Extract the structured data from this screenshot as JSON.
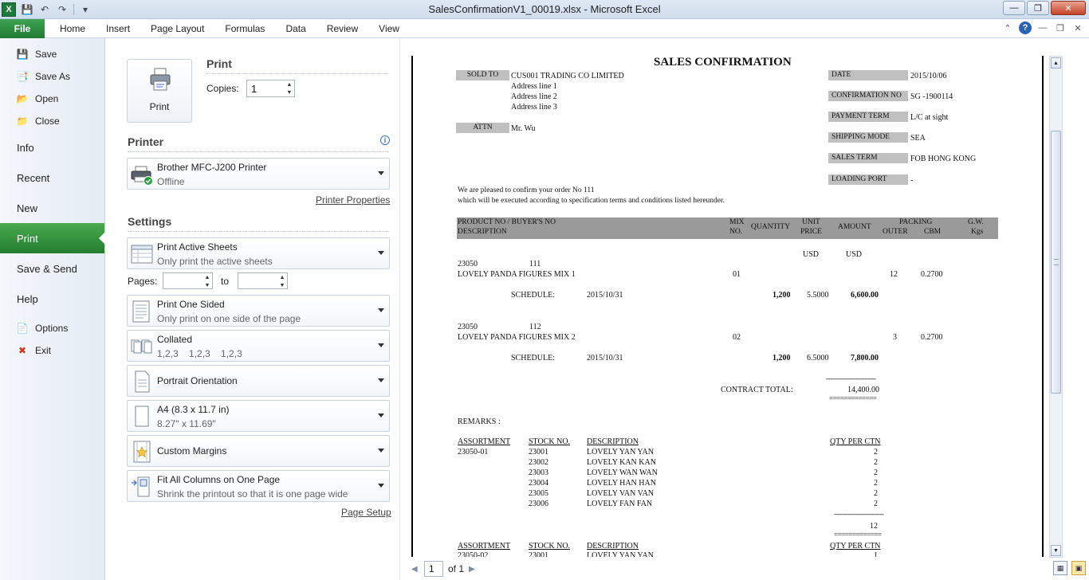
{
  "window": {
    "title": "SalesConfirmationV1_00019.xlsx  -  Microsoft Excel",
    "app_icon_letter": "X"
  },
  "ribbon": {
    "file_tab": "File",
    "tabs": [
      "Home",
      "Insert",
      "Page Layout",
      "Formulas",
      "Data",
      "Review",
      "View"
    ]
  },
  "backstage": {
    "items": [
      {
        "label": "Save",
        "icon": "save-icon"
      },
      {
        "label": "Save As",
        "icon": "save-as-icon"
      },
      {
        "label": "Open",
        "icon": "open-folder-icon"
      },
      {
        "label": "Close",
        "icon": "close-folder-icon"
      },
      {
        "label": "Info"
      },
      {
        "label": "Recent"
      },
      {
        "label": "New"
      },
      {
        "label": "Print",
        "active": true
      },
      {
        "label": "Save & Send"
      },
      {
        "label": "Help"
      },
      {
        "label": "Options",
        "icon": "options-icon"
      },
      {
        "label": "Exit",
        "icon": "exit-icon"
      }
    ]
  },
  "print": {
    "heading": "Print",
    "button_label": "Print",
    "copies_label": "Copies:",
    "copies_value": "1"
  },
  "printer": {
    "heading": "Printer",
    "name": "Brother MFC-J200 Printer",
    "status": "Offline",
    "properties_link": "Printer Properties"
  },
  "settings": {
    "heading": "Settings",
    "sheets": {
      "main": "Print Active Sheets",
      "sub": "Only print the active sheets"
    },
    "pages_label": "Pages:",
    "to_label": "to",
    "pages_from": "",
    "pages_to": "",
    "sided": {
      "main": "Print One Sided",
      "sub": "Only print on one side of the page"
    },
    "collated": {
      "main": "Collated",
      "sub": "1,2,3    1,2,3    1,2,3"
    },
    "orientation": {
      "main": "Portrait Orientation"
    },
    "paper": {
      "main": "A4 (8.3 x 11.7 in)",
      "sub": "8.27\" x 11.69\""
    },
    "margins": {
      "main": "Custom Margins"
    },
    "scaling": {
      "main": "Fit All Columns on One Page",
      "sub": "Shrink the printout so that it is one page wide"
    },
    "page_setup_link": "Page Setup"
  },
  "preview_nav": {
    "page": "1",
    "of_label": "of 1"
  },
  "document": {
    "title": "SALES CONFIRMATION",
    "sold_to_label": "SOLD TO",
    "sold_to_name": "CUS001 TRADING CO LIMITED",
    "address": [
      "Address line 1",
      "Address line 2",
      "Address line 3"
    ],
    "attn_label": "ATTN",
    "attn_value": "Mr. Wu",
    "info": [
      {
        "label": "DATE",
        "value": "2015/10/06"
      },
      {
        "label": "CONFIRMATION NO",
        "value": "SG -1900114"
      },
      {
        "label": "PAYMENT TERM",
        "value": "L/C at sight"
      },
      {
        "label": "SHIPPING MODE",
        "value": "SEA"
      },
      {
        "label": "SALES TERM",
        "value": "FOB HONG KONG"
      },
      {
        "label": "LOADING PORT",
        "value": "-"
      }
    ],
    "intro_line1": "We are pleased to confirm your order No 111",
    "intro_line2": "which will be executed according to specification terms and conditions listed hereunder.",
    "headers": {
      "product_no": "PRODUCT NO / BUYER'S NO",
      "description": "DESCRIPTION",
      "mix": "MIX",
      "no": "NO.",
      "quantity": "QUANTITY",
      "unit": "UNIT",
      "price": "PRICE",
      "amount": "AMOUNT",
      "packing": "PACKING",
      "outer": "OUTER",
      "cbm": "CBM",
      "gw": "G.W.",
      "kgs": "Kgs"
    },
    "currency_price": "USD",
    "currency_amount": "USD",
    "items": [
      {
        "product_no": "23050",
        "buyer_no": "111",
        "description": "LOVELY PANDA FIGURES MIX 1",
        "mix": "01",
        "outer": "12",
        "cbm": "0.2700",
        "schedule_label": "SCHEDULE:",
        "schedule_date": "2015/10/31",
        "quantity": "1,200",
        "price": "5.5000",
        "amount": "6,600.00"
      },
      {
        "product_no": "23050",
        "buyer_no": "112",
        "description": "LOVELY PANDA FIGURES MIX 2",
        "mix": "02",
        "outer": "3",
        "cbm": "0.2700",
        "schedule_label": "SCHEDULE:",
        "schedule_date": "2015/10/31",
        "quantity": "1,200",
        "price": "6.5000",
        "amount": "7,800.00"
      }
    ],
    "dash_line": "-------------------------",
    "double_line": "=============",
    "contract_total_label": "CONTRACT TOTAL:",
    "contract_total": "14,400.00",
    "remarks_label": "REMARKS :",
    "assort_headers": {
      "assortment": "ASSORTMENT",
      "stock_no": "STOCK NO.",
      "description": "DESCRIPTION",
      "qty": "QTY PER CTN"
    },
    "assortments": [
      {
        "code": "23050-01",
        "rows": [
          {
            "stock": "23001",
            "desc": "LOVELY YAN YAN",
            "qty": "2"
          },
          {
            "stock": "23002",
            "desc": "LOVELY KAN KAN",
            "qty": "2"
          },
          {
            "stock": "23003",
            "desc": "LOVELY WAN WAN",
            "qty": "2"
          },
          {
            "stock": "23004",
            "desc": "LOVELY HAN HAN",
            "qty": "2"
          },
          {
            "stock": "23005",
            "desc": "LOVELY VAN VAN",
            "qty": "2"
          },
          {
            "stock": "23006",
            "desc": "LOVELY FAN FAN",
            "qty": "2"
          }
        ],
        "total": "12"
      }
    ],
    "assort2_code": "23050-02",
    "assort2_first_stock": "23001",
    "assort2_first_desc": "LOVELY YAN YAN",
    "assort2_first_qty": "1"
  }
}
